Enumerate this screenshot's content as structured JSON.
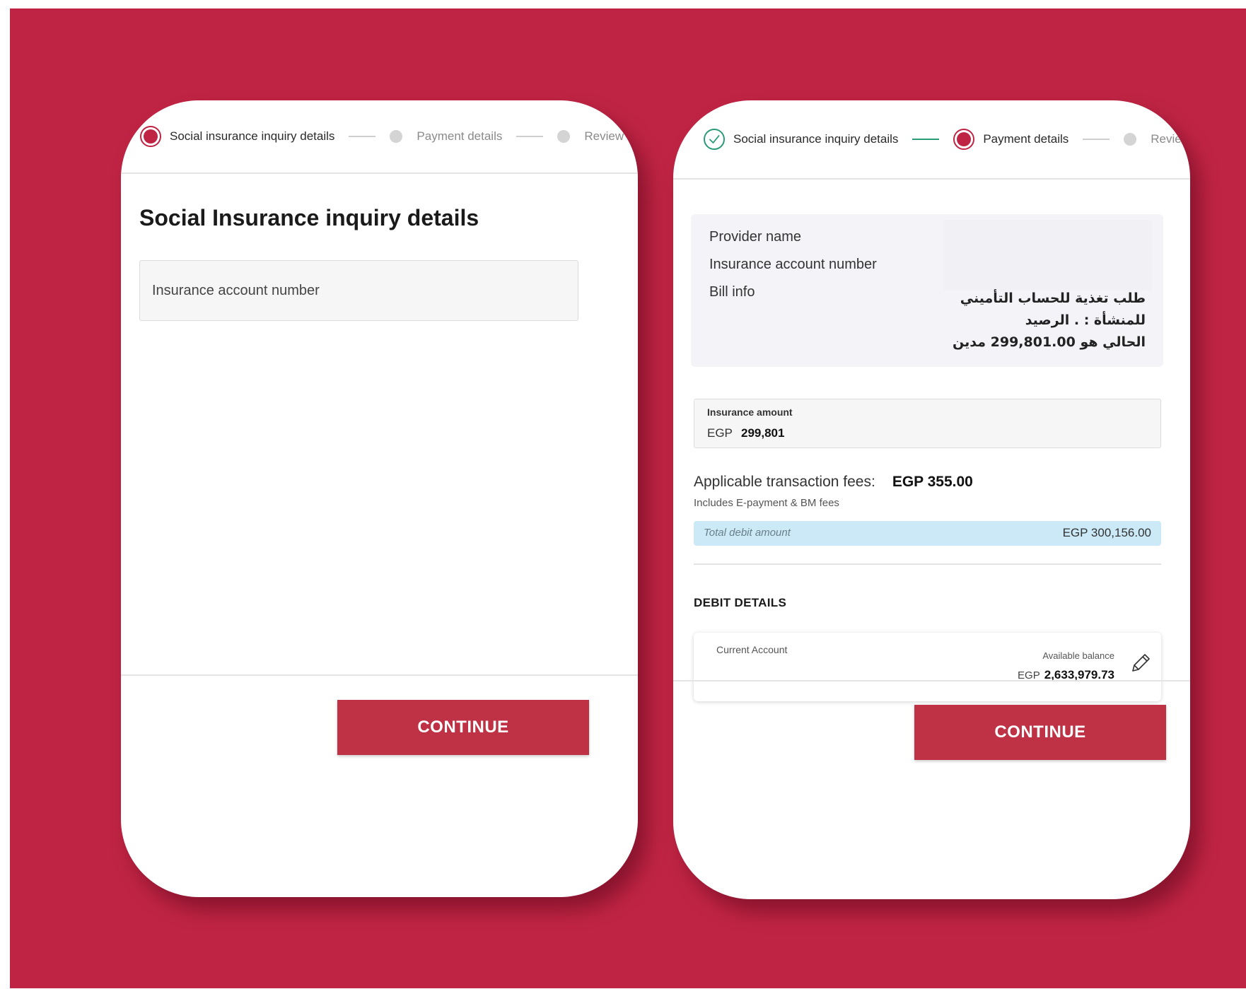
{
  "left_screen": {
    "stepper": [
      {
        "label": "Social insurance inquiry details",
        "state": "active"
      },
      {
        "label": "Payment details",
        "state": "pending"
      },
      {
        "label": "Review",
        "state": "pending"
      }
    ],
    "title": "Social Insurance inquiry details",
    "account_input": {
      "placeholder": "Insurance account number",
      "value": ""
    },
    "continue_label": "CONTINUE"
  },
  "right_screen": {
    "stepper": [
      {
        "label": "Social insurance inquiry details",
        "state": "done"
      },
      {
        "label": "Payment details",
        "state": "active"
      },
      {
        "label": "Review",
        "state": "pending"
      }
    ],
    "info": {
      "provider_label": "Provider name",
      "account_label": "Insurance account number",
      "bill_label": "Bill info",
      "bill_text_line1": "طلب تغذية للحساب التأميني",
      "bill_text_line2": "للمنشأة :           . الرصيد",
      "bill_text_line3": "الحالي هو 299,801.00 مدين"
    },
    "insurance_amount": {
      "label": "Insurance amount",
      "currency": "EGP",
      "value": "299,801"
    },
    "fees": {
      "label": "Applicable transaction fees:",
      "value": "EGP 355.00",
      "note": "Includes E-payment & BM fees"
    },
    "total": {
      "label": "Total debit amount",
      "value": "EGP 300,156.00"
    },
    "debit_section_title": "DEBIT DETAILS",
    "account": {
      "name": "Current Account",
      "balance_label": "Available balance",
      "currency": "EGP",
      "balance": "2,633,979.73"
    },
    "continue_label": "CONTINUE"
  },
  "colors": {
    "background": "#c02444",
    "accent": "#bf3144",
    "success": "#2a9a78",
    "total_bar": "#cbe9f7"
  },
  "icons": {
    "done_step": "check-icon",
    "edit": "pencil-icon"
  }
}
